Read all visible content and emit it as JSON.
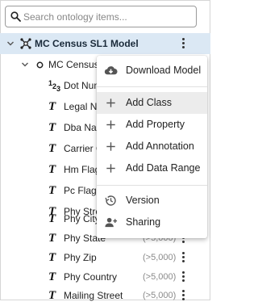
{
  "search": {
    "placeholder": "Search ontology items..."
  },
  "tree": {
    "root": {
      "label": "MC Census SL1 Model",
      "icon": "ontology-graph-icon"
    },
    "class": {
      "label": "MC Census A",
      "icon": "class-circle-icon"
    },
    "properties": [
      {
        "label": "Dot Num",
        "icon": "number-type-icon",
        "count": ""
      },
      {
        "label": "Legal Na",
        "icon": "text-type-icon",
        "count": ""
      },
      {
        "label": "Dba Nam",
        "icon": "text-type-icon",
        "count": ""
      },
      {
        "label": "Carrier O",
        "icon": "text-type-icon",
        "count": ""
      },
      {
        "label": "Hm Flag",
        "icon": "text-type-icon",
        "count": ""
      },
      {
        "label": "Pc Flag",
        "icon": "text-type-icon",
        "count": ""
      },
      {
        "label": "Phy Stree",
        "icon": "text-type-icon",
        "count": ""
      },
      {
        "label": "Phy City",
        "icon": "text-type-icon",
        "count": ""
      },
      {
        "label": "Phy State",
        "icon": "text-type-icon",
        "count": "(>5,000)"
      },
      {
        "label": "Phy Zip",
        "icon": "text-type-icon",
        "count": "(>5,000)"
      },
      {
        "label": "Phy Country",
        "icon": "text-type-icon",
        "count": "(>5,000)"
      },
      {
        "label": "Mailing Street",
        "icon": "text-type-icon",
        "count": "(>5,000)"
      }
    ]
  },
  "context_menu": {
    "download": {
      "label": "Download Model",
      "icon": "cloud-download-icon"
    },
    "add_class": {
      "label": "Add Class",
      "icon": "plus-icon"
    },
    "add_property": {
      "label": "Add Property",
      "icon": "plus-icon"
    },
    "add_annotation": {
      "label": "Add Annotation",
      "icon": "plus-icon"
    },
    "add_data_range": {
      "label": "Add Data Range",
      "icon": "plus-icon"
    },
    "version": {
      "label": "Version",
      "icon": "history-icon"
    },
    "sharing": {
      "label": "Sharing",
      "icon": "add-person-icon"
    }
  },
  "colors": {
    "selected_row": "#dbe8f4",
    "menu_hover": "#ececec",
    "count_text": "#8a8a8a"
  }
}
